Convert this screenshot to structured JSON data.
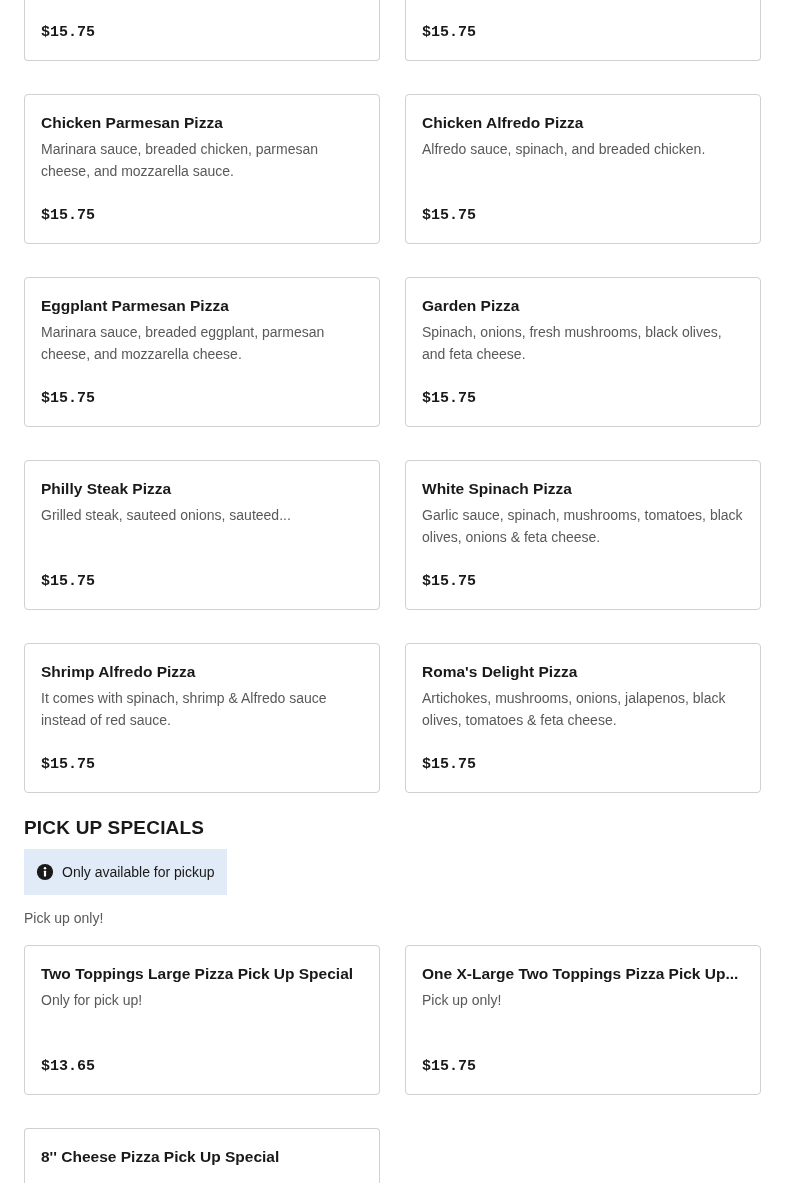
{
  "sections": [
    {
      "items": [
        {
          "kind": "cut_top",
          "price": "$15.75"
        },
        {
          "kind": "cut_top",
          "price": "$15.75"
        },
        {
          "kind": "full",
          "name": "Chicken Parmesan Pizza",
          "description": "Marinara sauce, breaded chicken, parmesan cheese, and mozzarella sauce.",
          "price": "$15.75"
        },
        {
          "kind": "full",
          "name": "Chicken Alfredo Pizza",
          "description": "Alfredo sauce, spinach, and breaded chicken.",
          "price": "$15.75"
        },
        {
          "kind": "full",
          "name": "Eggplant Parmesan Pizza",
          "description": "Marinara sauce, breaded eggplant, parmesan cheese, and mozzarella cheese.",
          "price": "$15.75"
        },
        {
          "kind": "full",
          "name": "Garden Pizza",
          "description": "Spinach, onions, fresh mushrooms, black olives, and feta cheese.",
          "price": "$15.75"
        },
        {
          "kind": "full",
          "name": "Philly Steak Pizza",
          "description": "Grilled steak, sauteed onions, sauteed...",
          "price": "$15.75"
        },
        {
          "kind": "full",
          "name": "White Spinach Pizza",
          "description": "Garlic sauce, spinach, mushrooms, tomatoes, black olives, onions & feta cheese.",
          "price": "$15.75"
        },
        {
          "kind": "full",
          "name": "Shrimp Alfredo Pizza",
          "description": "It comes with spinach, shrimp & Alfredo sauce instead of red sauce.",
          "price": "$15.75"
        },
        {
          "kind": "full",
          "name": "Roma's Delight Pizza",
          "description": "Artichokes, mushrooms, onions, jalapenos, black olives, tomatoes & feta cheese.",
          "price": "$15.75"
        }
      ]
    },
    {
      "heading": "PICK UP SPECIALS",
      "notice": "Only available for pickup",
      "description": "Pick up only!",
      "items": [
        {
          "kind": "full",
          "name": "Two Toppings Large Pizza Pick Up Special",
          "description": "Only for pick up!",
          "price": "$13.65"
        },
        {
          "kind": "full",
          "name": "One X-Large Two Toppings Pizza Pick Up...",
          "description": "Pick up only!",
          "price": "$15.75"
        },
        {
          "kind": "cut_bottom",
          "name": "8'' Cheese Pizza Pick Up Special"
        }
      ]
    }
  ]
}
